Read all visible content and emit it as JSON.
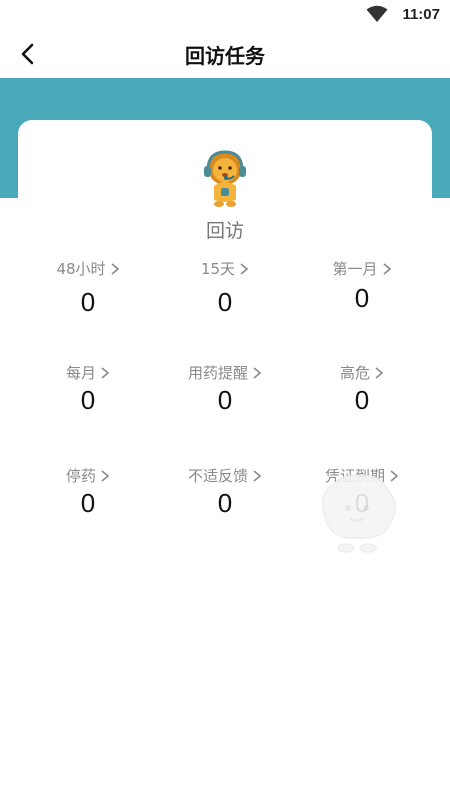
{
  "status_bar": {
    "time": "11:07"
  },
  "header": {
    "title": "回访任务"
  },
  "card": {
    "title": "回访"
  },
  "tasks": [
    {
      "label": "48小时",
      "value": "0"
    },
    {
      "label": "15天",
      "value": "0"
    },
    {
      "label": "第一月",
      "value": "0"
    },
    {
      "label": "每月",
      "value": "0"
    },
    {
      "label": "用药提醒",
      "value": "0"
    },
    {
      "label": "高危",
      "value": "0"
    },
    {
      "label": "停药",
      "value": "0"
    },
    {
      "label": "不适反馈",
      "value": "0"
    },
    {
      "label": "凭证到期",
      "value": "0"
    }
  ],
  "colors": {
    "header_band": "#4aa9b8",
    "label": "#8a8a8a",
    "value": "#111111"
  }
}
